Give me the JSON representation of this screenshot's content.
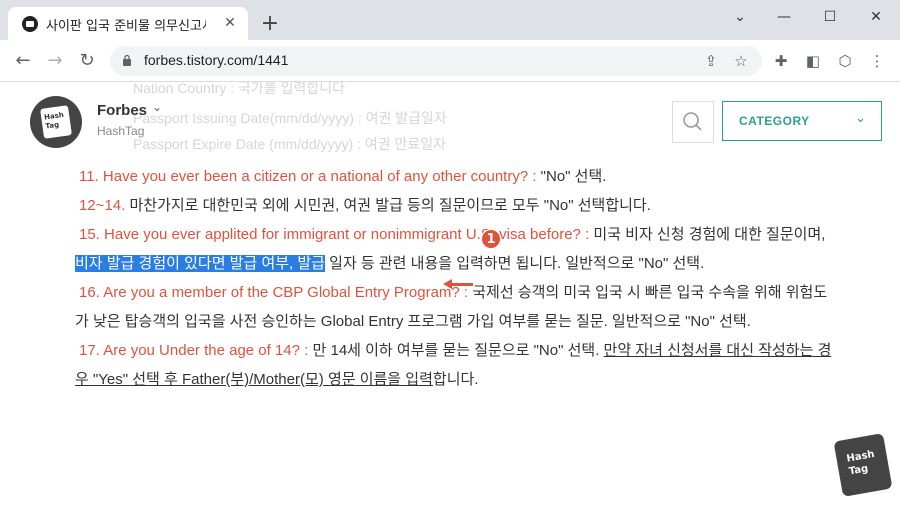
{
  "browser": {
    "tab_title": "사이판 입국 준비물 의무신고서(",
    "tab_close": "✕",
    "new_tab": "+",
    "window_controls": [
      "⌄",
      "—",
      "☐",
      "✕"
    ],
    "url": "forbes.tistory.com/1441",
    "nav": {
      "back": "←",
      "forward": "→",
      "reload": "↻"
    }
  },
  "site": {
    "name": "Forbes",
    "subtitle": "HashTag",
    "logo_text": "Hash\nTag",
    "category_label": "CATEGORY"
  },
  "ghost_lines": [
    "Nation Country : 국가를 입력합니다",
    "Passport Issuing Date(mm/dd/yyyy) : 여권 발급일자",
    "Passport Expire Date (mm/dd/yyyy) : 여권 만료일자"
  ],
  "article": {
    "p1": {
      "q": "11. Have you ever been a citizen or a national of any other country? :",
      "rest": " \"No\" 선택."
    },
    "p2": {
      "q": "12~14.",
      "rest": " 마찬가지로 대한민국 외에 시민권, 여권 발급 등의 질문이므로 모두 \"No\" 선택합니다."
    },
    "p3": {
      "q": "15. Have you ever applited for immigrant or nonimmigrant U.S. visa before? :",
      "rest1": " 미국 비자 신청 경험에 대한 질문이며, ",
      "highlight": "비자 발급 경험이 있다면 발급 여부, 발급",
      "rest2": " 일자 등 관련 내용을 입력하면 됩니다. 일반적으로 \"No\" 선택."
    },
    "p4": {
      "q": "16. Are you a member of the CBP Global Entry Program? :",
      "rest": " 국제선 승객의 미국 입국 시 빠른 입국 수속을 위해 위험도가 낮은 탑승객의 입국을 사전 승인하는 Global Entry 프로그램 가입 여부를 묻는 질문. 일반적으로 \"No\" 선택."
    },
    "p5": {
      "q": "17. Are you Under the age of 14? :",
      "rest1": " 만 14세 이하 여부를 묻는 질문으로 \"No\" 선택. ",
      "underline": "만약 자녀 신청서를 대신 작성하는 경우 \"Yes\" 선택 후 Father(부)/Mother(모) 영문 이름을 입력",
      "rest2": "합니다."
    }
  },
  "annotation": {
    "badge": "1"
  },
  "corner_logo": "Hash\nTag"
}
